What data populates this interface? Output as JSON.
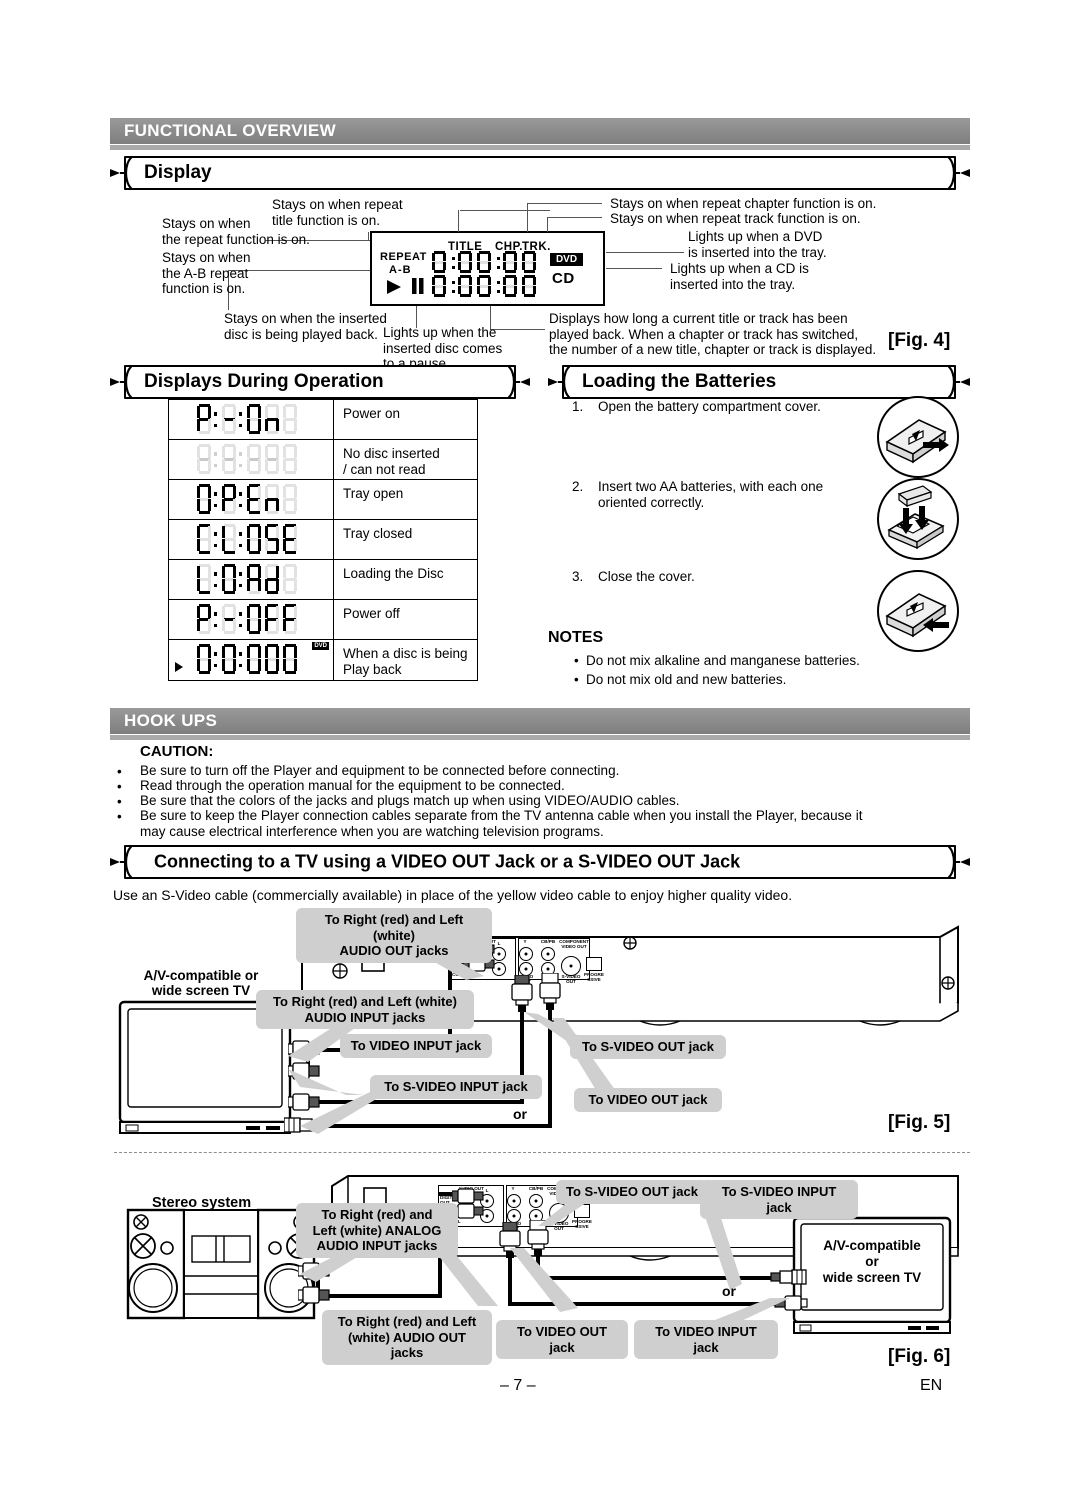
{
  "sections": {
    "functional_overview": "FUNCTIONAL OVERVIEW",
    "hook_ups": "HOOK UPS"
  },
  "display": {
    "heading": "Display",
    "fig_label": "[Fig. 4]",
    "panel": {
      "repeat": "REPEAT",
      "ab": "A-B",
      "title": "TITLE",
      "chp": "CHP.",
      "trk": "TRK.",
      "dvd": "DVD",
      "cd": "CD",
      "time_top": "0:00:00",
      "time_bottom": "0:00:00"
    },
    "annotations": {
      "repeat_fn": "Stays on when\nthe repeat function is on.",
      "ab_repeat": "Stays on when\nthe A-B repeat\nfunction is on.",
      "repeat_title": "Stays on when repeat\ntitle function is on.",
      "repeat_chapter": "Stays on when repeat chapter function is on.",
      "repeat_track": "Stays on when repeat track function is on.",
      "dvd_inserted": "Lights up when a DVD\nis inserted into the tray.",
      "cd_inserted": "Lights up when a CD is\ninserted into the tray.",
      "playing": "Stays on when the inserted\ndisc is being played back.",
      "paused": "Lights up when the\ninserted disc comes\nto a pause.",
      "elapsed": "Displays how long a current title or track has been\nplayed back. When a chapter or track has switched,\nthe number of a new title, chapter or track is displayed."
    }
  },
  "displays_during_operation": {
    "heading": "Displays During Operation",
    "rows": [
      {
        "segments": "P-On",
        "label": "Power on",
        "dim": false,
        "play": false,
        "dvd": false
      },
      {
        "segments": "----",
        "label": "No disc inserted\n / can not read",
        "dim": true,
        "play": false,
        "dvd": false
      },
      {
        "segments": "OPEn",
        "label": "Tray open",
        "dim": false,
        "play": false,
        "dvd": false
      },
      {
        "segments": "CLOSE",
        "label": "Tray closed",
        "dim": false,
        "play": false,
        "dvd": false
      },
      {
        "segments": "LOAd",
        "label": "Loading the Disc",
        "dim": false,
        "play": false,
        "dvd": false
      },
      {
        "segments": "P-OFF",
        "label": "Power off",
        "dim": false,
        "play": false,
        "dvd": false
      },
      {
        "segments": "0:00:00",
        "label": "When a disc is being\nPlay back",
        "dim": false,
        "play": true,
        "dvd": true
      }
    ]
  },
  "loading_batteries": {
    "heading": "Loading the Batteries",
    "steps": [
      {
        "num": "1.",
        "text": "Open the battery compartment cover."
      },
      {
        "num": "2.",
        "text": "Insert two AA batteries, with each one\noriented correctly."
      },
      {
        "num": "3.",
        "text": "Close the cover."
      }
    ],
    "notes_heading": "NOTES",
    "notes": [
      "Do not mix alkaline and manganese batteries.",
      "Do not mix old and new batteries."
    ]
  },
  "caution": {
    "heading": "CAUTION:",
    "items": [
      "Be sure to turn off the Player and equipment to be connected before connecting.",
      "Read through the operation manual for the equipment to be connected.",
      "Be sure that the colors of the jacks and plugs match up when using VIDEO/AUDIO cables.",
      "Be sure to keep the Player connection cables separate from the TV antenna cable when you install the Player, because it\nmay cause electrical interference when you are watching television programs."
    ]
  },
  "connecting": {
    "heading": "Connecting to a TV using a VIDEO OUT Jack or a S-VIDEO OUT Jack",
    "intro": "Use an S-Video cable (commercially available) in place of the yellow video cable to enjoy higher quality video."
  },
  "fig5": {
    "fig_label": "[Fig. 5]",
    "tv_label": "A/V-compatible or\nwide screen TV",
    "or_label": "or",
    "callouts": {
      "audio_out": "To Right (red) and Left (white)\nAUDIO OUT jacks",
      "audio_input": "To Right (red) and Left (white)\nAUDIO INPUT jacks",
      "video_input": "To VIDEO INPUT jack",
      "svideo_input": "To S-VIDEO INPUT jack",
      "svideo_out": "To S-VIDEO OUT jack",
      "video_out": "To VIDEO OUT jack"
    }
  },
  "fig6": {
    "fig_label": "[Fig. 6]",
    "stereo_label": "Stereo system",
    "tv_label": "A/V-compatible\nor\nwide screen TV",
    "or_label": "or",
    "callouts": {
      "analog_audio_input": "To Right (red) and\nLeft (white) ANALOG\nAUDIO INPUT jacks",
      "audio_out": "To Right (red) and Left\n(white) AUDIO OUT jacks",
      "svideo_out": "To S-VIDEO OUT jack",
      "svideo_input": "To S-VIDEO INPUT jack",
      "video_out": "To VIDEO OUT jack",
      "video_input": "To VIDEO INPUT jack"
    }
  },
  "rear_panel": {
    "audio_out": "AUDIO OUT",
    "digital_out": "DIGITAL\nOUT",
    "bitstream": "BITSTREAM",
    "coaxial": "COAXIAL",
    "l": "L",
    "r": "R",
    "y": "Y",
    "cbpb": "CB/PB",
    "crpr": "CR/PR",
    "component": "COMPONENT\nVIDEO OUT",
    "video_out": "VIDEO\nOUT",
    "svideo_out": "S-VIDEO\nOUT",
    "progressive": "PROGRE\nSSIVE"
  },
  "footer": {
    "page": "– 7 –",
    "lang": "EN"
  }
}
